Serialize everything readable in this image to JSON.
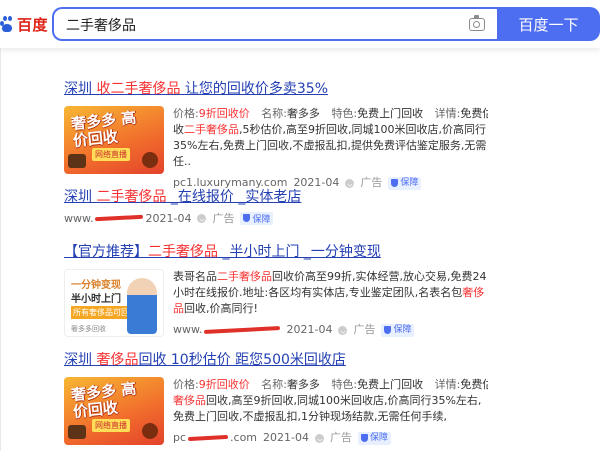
{
  "header": {
    "logo_text": "百度",
    "search_value": "二手奢侈品",
    "search_button": "百度一下"
  },
  "results": [
    {
      "title_prefix": "深圳 ",
      "title_em": "收二手奢侈品",
      "title_suffix": " 让您的回收价多卖35%",
      "thumb_main": "奢多多 高价回收",
      "thumb_tag": "网络直播",
      "info": {
        "price_label": "价格:",
        "price_value": "9折回收价",
        "name_label": "名称:",
        "name_value": "奢多多",
        "feature_label": "特色:",
        "feature_value": "免费上门回收",
        "detail_label": "详情:",
        "detail_value": "免费估价"
      },
      "desc_a": "收",
      "desc_em": "二手奢侈品",
      "desc_b": ",5秒估价,高至9折回收,同城100米回收店,价高同行35%左右,免费上门回收,不虚报乱扣,提供免费评估鉴定服务,无需任..",
      "url": "pc1.luxurymany.com",
      "date": "2021-04",
      "ad_label": "广告",
      "badge": "保障"
    },
    {
      "title_prefix": "深圳 ",
      "title_em": "二手奢侈品",
      "title_suffix": " _在线报价 _实体老店",
      "url_start": "www.",
      "date": "2021-04",
      "ad_label": "广告",
      "badge": "保障"
    },
    {
      "title_prefix": "【官方推荐】",
      "title_em": "二手奢侈品",
      "title_suffix": " _半小时上门 _一分钟变现",
      "thumb_l1": "一分钟变现",
      "thumb_l2": "半小时上门",
      "thumb_l3": "所有奢侈品可回收",
      "thumb_logo": "奢多多回收",
      "desc_a": "表哥名品",
      "desc_em": "二手奢侈品",
      "desc_b": "回收价高至99折,实体经营,放心交易,免费24小时在线报价.地址:各区均有实体店,专业鉴定团队,名表名包",
      "desc_em2": "奢侈品",
      "desc_c": "回收,价高同行!",
      "url_start": "www.",
      "date": "2021-04",
      "ad_label": "广告",
      "badge": "保障"
    },
    {
      "title_prefix": "深圳 ",
      "title_em": "奢侈品",
      "title_suffix": "回收 10秒估价 距您500米回收店",
      "thumb_main": "奢多多 高价回收",
      "thumb_tag": "网络直播",
      "info": {
        "price_label": "价格:",
        "price_value": "9折回收价",
        "name_label": "名称:",
        "name_value": "奢多多",
        "feature_label": "特色:",
        "feature_value": "免费上门回收",
        "detail_label": "详情:",
        "detail_value": "免费估价"
      },
      "desc_em": "奢侈品",
      "desc_b": "回收,高至9折回收,同城100米回收店,价高同行35%左右,免费上门回收,不虚报乱扣,1分钟现场结款,无需任何手续,",
      "url_start": "pc",
      "url_end": ".com",
      "date": "2021-04",
      "ad_label": "广告",
      "badge": "保障"
    }
  ],
  "colors": {
    "accent": "#4e6ef2",
    "link": "#2440b3",
    "highlight": "#f73131",
    "logo_red": "#de2316"
  }
}
